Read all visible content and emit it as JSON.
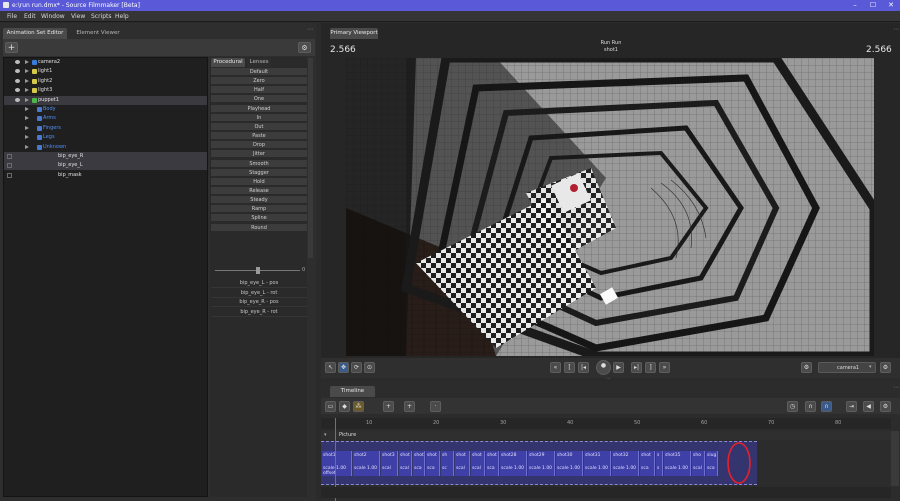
{
  "window": {
    "title": "e:\\run run.dmx* - Source Filmmaker [Beta]",
    "controls": [
      "minimize",
      "maximize",
      "close"
    ]
  },
  "menu": [
    "File",
    "Edit",
    "Window",
    "View",
    "Scripts",
    "Help"
  ],
  "left_tabs": [
    "Animation Set Editor",
    "Element Viewer"
  ],
  "tree": [
    {
      "label": "camera2",
      "icon": "camera-icon",
      "color": "#e0e0e0"
    },
    {
      "label": "light1",
      "icon": "light-icon",
      "color": "#e0e0e0"
    },
    {
      "label": "light2",
      "icon": "light-icon",
      "color": "#e0e0e0"
    },
    {
      "label": "light3",
      "icon": "light-icon",
      "color": "#e0e0e0"
    },
    {
      "label": "puppet1",
      "icon": "puppet-icon",
      "color": "#e0e0e0"
    },
    {
      "label": "Body",
      "color": "#4f8ff0"
    },
    {
      "label": "Arms",
      "color": "#4f8ff0"
    },
    {
      "label": "Fingers",
      "color": "#4f8ff0"
    },
    {
      "label": "Legs",
      "color": "#4f8ff0"
    },
    {
      "label": "Unknown",
      "color": "#4f8ff0"
    },
    {
      "label": "bip_eye_R",
      "color": "#e0e0e0"
    },
    {
      "label": "bip_eye_L",
      "color": "#e0e0e0"
    },
    {
      "label": "bip_mask",
      "color": "#e0e0e0"
    }
  ],
  "proc_tabs": [
    "Procedural",
    "Lenses"
  ],
  "proc_buttons": [
    "Default",
    "Zero",
    "Half",
    "One",
    "Playhead",
    "In",
    "Out",
    "Paste",
    "Drop",
    "Jitter",
    "Smooth",
    "Stagger",
    "Hold",
    "Release",
    "Steady",
    "Ramp",
    "Spline",
    "Round"
  ],
  "slider_value": "0",
  "channels": [
    "bip_eye_L - pos",
    "bip_eye_L - rot",
    "bip_eye_R - pos",
    "bip_eye_R - rot"
  ],
  "viewport": {
    "tab": "Primary Viewport",
    "left_num": "2.566",
    "right_num": "2.566",
    "center_title": "Run Run",
    "center_sub": "shot1",
    "camera": "camera1"
  },
  "timeline": {
    "tab": "Timeline",
    "track_label": "Picture",
    "ruler": [
      "10",
      "20",
      "30",
      "40",
      "50",
      "60",
      "70",
      "80"
    ],
    "clips": [
      {
        "name": "shot1",
        "scale": "scale 1.00 offset"
      },
      {
        "name": "shot2",
        "scale": "scale 1.00"
      },
      {
        "name": "shot3",
        "scale": "scal"
      },
      {
        "name": "shot",
        "scale": "scal"
      },
      {
        "name": "shot",
        "scale": "sca"
      },
      {
        "name": "shot",
        "scale": "sca"
      },
      {
        "name": "sh",
        "scale": "sc"
      },
      {
        "name": "shot",
        "scale": "scal"
      },
      {
        "name": "shot",
        "scale": "scal"
      },
      {
        "name": "shot",
        "scale": "sca"
      },
      {
        "name": "shot28",
        "scale": "scale 1.00"
      },
      {
        "name": "shot29",
        "scale": "scale 1.00"
      },
      {
        "name": "shot30",
        "scale": "scale 1.00"
      },
      {
        "name": "shot31",
        "scale": "scale 1.00"
      },
      {
        "name": "shot32",
        "scale": "scale 1.00"
      },
      {
        "name": "shot",
        "scale": "sca"
      },
      {
        "name": "s",
        "scale": "s"
      },
      {
        "name": "shot35",
        "scale": "scale 1.00"
      },
      {
        "name": "sho",
        "scale": "scal"
      },
      {
        "name": "slug",
        "scale": "sca"
      }
    ]
  },
  "colors": {
    "titlebar": "#5a5ad8",
    "clip": "#3f3fa8",
    "annotation": "#e8202a"
  }
}
